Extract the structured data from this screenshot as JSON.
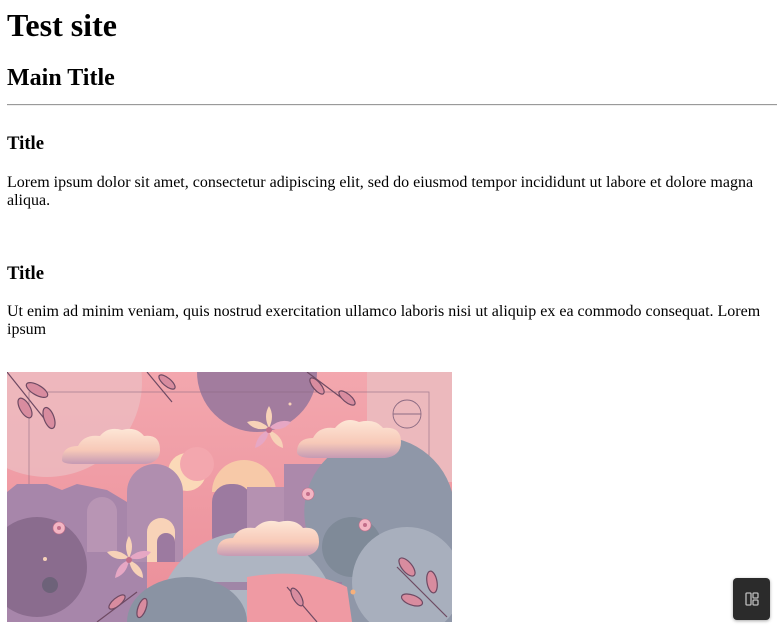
{
  "site": {
    "title": "Test site"
  },
  "main": {
    "title": "Main Title",
    "sections": [
      {
        "title": "Title",
        "text": "Lorem ipsum dolor sit amet, consectetur adipiscing elit, sed do eiusmod tempor incididunt ut labore et dolore magna aliqua."
      },
      {
        "title": "Title",
        "text": "Ut enim ad minim veniam, quis nostrud exercitation ullamco laboris nisi ut aliquip ex ea commodo consequat. Lorem ipsum"
      }
    ],
    "image": {
      "subject": "pastel-pink-illustration-clouds-moon-flowers",
      "palette": [
        "#f2a0a8",
        "#9c7aa0",
        "#f8d2c0",
        "#8f98a8"
      ]
    }
  },
  "floating_button": {
    "icon": "layout-panels-icon",
    "background": "#2b2b2b"
  }
}
